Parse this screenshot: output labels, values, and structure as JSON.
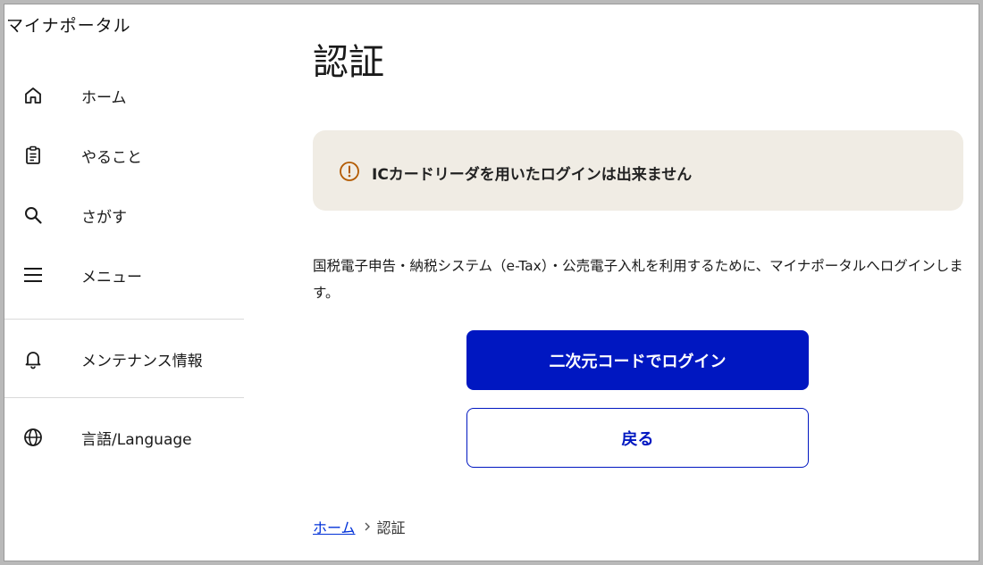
{
  "app": {
    "title": "マイナポータル"
  },
  "sidebar": {
    "items": [
      {
        "label": "ホーム",
        "icon": "home-icon"
      },
      {
        "label": "やること",
        "icon": "clipboard-icon"
      },
      {
        "label": "さがす",
        "icon": "search-icon"
      },
      {
        "label": "メニュー",
        "icon": "menu-icon"
      },
      {
        "label": "メンテナンス情報",
        "icon": "bell-icon"
      },
      {
        "label": "言語/Language",
        "icon": "globe-icon"
      }
    ]
  },
  "main": {
    "title": "認証",
    "alert": {
      "text": "ICカードリーダを用いたログインは出来ません",
      "icon": "warning-circle-icon"
    },
    "description": "国税電子申告・納税システム（e-Tax）・公売電子入札を利用するために、マイナポータルへログインします。",
    "buttons": {
      "primary": "二次元コードでログイン",
      "secondary": "戻る"
    },
    "breadcrumb": {
      "home": "ホーム",
      "current": "認証"
    }
  },
  "colors": {
    "primary": "#0017c1",
    "link": "#0031d8",
    "alert_bg": "#f0ece4",
    "alert_icon": "#b35a00"
  }
}
